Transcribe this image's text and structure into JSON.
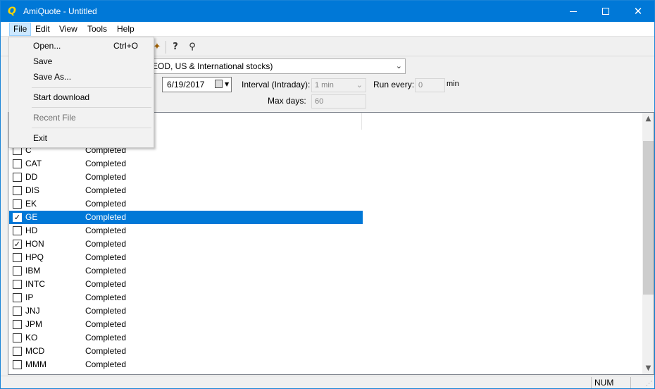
{
  "window": {
    "title": "AmiQuote - Untitled",
    "app_icon_glyph": "Q",
    "controls": {
      "minimize": "",
      "maximize": "",
      "close": "✕"
    }
  },
  "menubar": {
    "items": [
      "File",
      "Edit",
      "View",
      "Tools",
      "Help"
    ],
    "active": "File"
  },
  "file_menu": {
    "open": "Open...",
    "open_shortcut": "Ctrl+O",
    "save": "Save",
    "save_as": "Save As...",
    "start_download": "Start download",
    "recent_file": "Recent File",
    "exit": "Exit"
  },
  "toolbar": {
    "icons": [
      "wand-icon",
      "help-icon",
      "find-icon"
    ],
    "glyphs": {
      "wand": "✦",
      "help": "?",
      "find": "⚲"
    }
  },
  "settings": {
    "source_value": "EOD, US & International stocks)",
    "date_value": "6/19/2017",
    "interval_label": "Interval (Intraday):",
    "interval_value": "1 min",
    "run_every_label": "Run every:",
    "run_every_value": "0",
    "run_every_unit": "min",
    "max_days_label": "Max days:",
    "max_days_value": "60"
  },
  "tickers": [
    {
      "symbol": "C",
      "status": "Completed",
      "checked": false,
      "selected": false
    },
    {
      "symbol": "CAT",
      "status": "Completed",
      "checked": false,
      "selected": false
    },
    {
      "symbol": "DD",
      "status": "Completed",
      "checked": false,
      "selected": false
    },
    {
      "symbol": "DIS",
      "status": "Completed",
      "checked": false,
      "selected": false
    },
    {
      "symbol": "EK",
      "status": "Completed",
      "checked": false,
      "selected": false
    },
    {
      "symbol": "GE",
      "status": "Completed",
      "checked": true,
      "selected": true
    },
    {
      "symbol": "HD",
      "status": "Completed",
      "checked": false,
      "selected": false
    },
    {
      "symbol": "HON",
      "status": "Completed",
      "checked": true,
      "selected": false
    },
    {
      "symbol": "HPQ",
      "status": "Completed",
      "checked": false,
      "selected": false
    },
    {
      "symbol": "IBM",
      "status": "Completed",
      "checked": false,
      "selected": false
    },
    {
      "symbol": "INTC",
      "status": "Completed",
      "checked": false,
      "selected": false
    },
    {
      "symbol": "IP",
      "status": "Completed",
      "checked": false,
      "selected": false
    },
    {
      "symbol": "JNJ",
      "status": "Completed",
      "checked": false,
      "selected": false
    },
    {
      "symbol": "JPM",
      "status": "Completed",
      "checked": false,
      "selected": false
    },
    {
      "symbol": "KO",
      "status": "Completed",
      "checked": false,
      "selected": false
    },
    {
      "symbol": "MCD",
      "status": "Completed",
      "checked": false,
      "selected": false
    },
    {
      "symbol": "MMM",
      "status": "Completed",
      "checked": false,
      "selected": false
    }
  ],
  "statusbar": {
    "num": "NUM"
  },
  "colors": {
    "titlebar": "#0078d7",
    "selection": "#0078d7",
    "menu_active": "#cce8ff"
  }
}
